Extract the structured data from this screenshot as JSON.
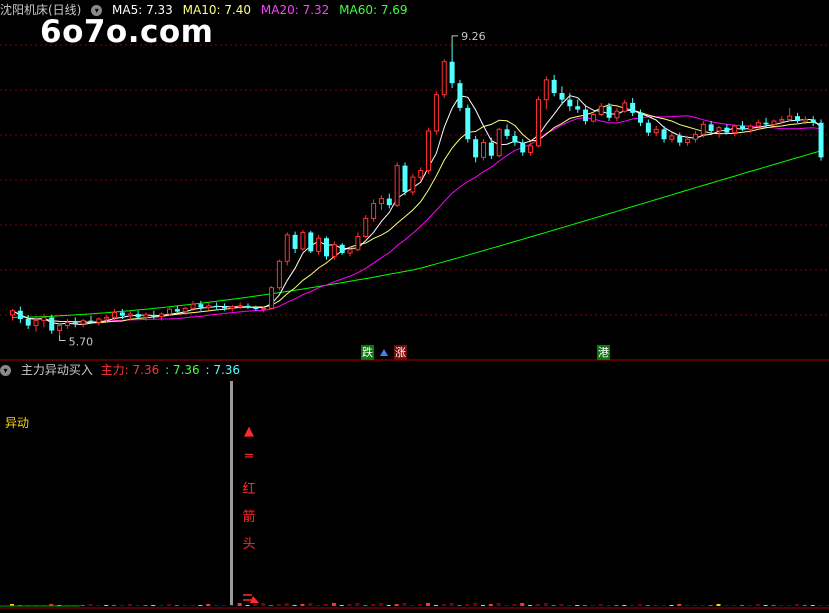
{
  "header": {
    "title": "沈阳机床(日线)",
    "ma5": "MA5: 7.33",
    "ma10": "MA10: 7.40",
    "ma20": "MA20: 7.32",
    "ma60": "MA60: 7.69",
    "toggle_glyph": "▾"
  },
  "watermark": "6o7o.com",
  "price_annotations": {
    "high": "9.26",
    "low": "5.70"
  },
  "event_tags": [
    {
      "text": "跌",
      "bg": "#0a7a0a",
      "fg": "#ffffff"
    },
    {
      "text": "涨",
      "bg": "#7a0a0a",
      "fg": "#ffffff"
    },
    {
      "text": "港",
      "bg": "#0a7a0a",
      "fg": "#ffffff"
    }
  ],
  "indicator": {
    "title": "主力异动买入",
    "main_label": "主力: 7.36",
    "v2": ": 7.36",
    "v3": ": 7.36",
    "left_label": "异动",
    "vertical_label": [
      "▲",
      "=",
      "红",
      "箭",
      "头"
    ]
  },
  "colors": {
    "up": "#ff3232",
    "down": "#54ffff",
    "ma5": "#ffffff",
    "ma10": "#ffff80",
    "ma20": "#ff00ff",
    "ma60": "#00ff00",
    "grid": "#8a0000",
    "divider": "#b00000"
  },
  "chart_data": {
    "type": "candlestick",
    "high_marker": 9.26,
    "low_marker": 5.7,
    "ohlc": [
      [
        5.95,
        6.02,
        5.88,
        6.0
      ],
      [
        6.0,
        6.05,
        5.85,
        5.9
      ],
      [
        5.9,
        5.95,
        5.78,
        5.82
      ],
      [
        5.82,
        5.92,
        5.75,
        5.88
      ],
      [
        5.88,
        5.96,
        5.8,
        5.92
      ],
      [
        5.92,
        5.95,
        5.72,
        5.76
      ],
      [
        5.76,
        5.85,
        5.7,
        5.82
      ],
      [
        5.82,
        5.9,
        5.78,
        5.86
      ],
      [
        5.86,
        5.92,
        5.8,
        5.84
      ],
      [
        5.84,
        5.9,
        5.8,
        5.88
      ],
      [
        5.88,
        5.94,
        5.84,
        5.86
      ],
      [
        5.86,
        5.92,
        5.82,
        5.9
      ],
      [
        5.9,
        5.95,
        5.86,
        5.92
      ],
      [
        5.92,
        6.02,
        5.88,
        5.98
      ],
      [
        5.98,
        6.02,
        5.9,
        5.94
      ],
      [
        5.94,
        6.0,
        5.88,
        5.96
      ],
      [
        5.96,
        6.0,
        5.9,
        5.92
      ],
      [
        5.92,
        5.98,
        5.88,
        5.95
      ],
      [
        5.95,
        6.0,
        5.9,
        5.93
      ],
      [
        5.93,
        5.98,
        5.88,
        5.96
      ],
      [
        5.96,
        6.04,
        5.94,
        6.02
      ],
      [
        6.02,
        6.06,
        5.96,
        5.99
      ],
      [
        5.99,
        6.05,
        5.95,
        6.03
      ],
      [
        6.03,
        6.12,
        6.0,
        6.08
      ],
      [
        6.08,
        6.12,
        6.0,
        6.04
      ],
      [
        6.04,
        6.1,
        6.0,
        6.06
      ],
      [
        6.06,
        6.1,
        6.02,
        6.05
      ],
      [
        6.05,
        6.09,
        6.0,
        6.03
      ],
      [
        6.03,
        6.07,
        5.99,
        6.05
      ],
      [
        6.05,
        6.1,
        6.02,
        6.06
      ],
      [
        6.06,
        6.09,
        6.02,
        6.04
      ],
      [
        6.04,
        6.06,
        6.0,
        6.02
      ],
      [
        6.02,
        6.05,
        5.98,
        6.03
      ],
      [
        6.03,
        6.3,
        6.02,
        6.28
      ],
      [
        6.28,
        6.62,
        6.25,
        6.6
      ],
      [
        6.6,
        6.95,
        6.55,
        6.92
      ],
      [
        6.92,
        6.96,
        6.7,
        6.75
      ],
      [
        6.75,
        6.98,
        6.72,
        6.95
      ],
      [
        6.95,
        6.97,
        6.7,
        6.72
      ],
      [
        6.72,
        6.92,
        6.68,
        6.88
      ],
      [
        6.88,
        6.9,
        6.62,
        6.66
      ],
      [
        6.66,
        6.84,
        6.62,
        6.8
      ],
      [
        6.8,
        6.82,
        6.68,
        6.7
      ],
      [
        6.7,
        6.78,
        6.66,
        6.74
      ],
      [
        6.74,
        6.95,
        6.72,
        6.9
      ],
      [
        6.9,
        7.16,
        6.88,
        7.12
      ],
      [
        7.12,
        7.35,
        7.08,
        7.3
      ],
      [
        7.3,
        7.4,
        7.22,
        7.36
      ],
      [
        7.36,
        7.42,
        7.24,
        7.28
      ],
      [
        7.28,
        7.8,
        7.26,
        7.76
      ],
      [
        7.76,
        7.8,
        7.4,
        7.44
      ],
      [
        7.44,
        7.66,
        7.4,
        7.62
      ],
      [
        7.62,
        7.74,
        7.58,
        7.7
      ],
      [
        7.7,
        8.22,
        7.66,
        8.18
      ],
      [
        8.18,
        8.66,
        8.14,
        8.62
      ],
      [
        8.62,
        9.05,
        8.58,
        9.02
      ],
      [
        9.02,
        9.26,
        8.7,
        8.76
      ],
      [
        8.76,
        8.8,
        8.42,
        8.46
      ],
      [
        8.46,
        8.5,
        8.04,
        8.08
      ],
      [
        8.08,
        8.12,
        7.8,
        7.86
      ],
      [
        7.86,
        8.08,
        7.82,
        8.04
      ],
      [
        8.04,
        8.1,
        7.84,
        7.88
      ],
      [
        7.88,
        8.22,
        7.86,
        8.2
      ],
      [
        8.2,
        8.26,
        8.08,
        8.12
      ],
      [
        8.12,
        8.18,
        8.0,
        8.04
      ],
      [
        8.04,
        8.08,
        7.88,
        7.92
      ],
      [
        7.92,
        8.04,
        7.88,
        8.0
      ],
      [
        8.0,
        8.6,
        7.98,
        8.56
      ],
      [
        8.56,
        8.84,
        8.44,
        8.8
      ],
      [
        8.8,
        8.86,
        8.6,
        8.64
      ],
      [
        8.64,
        8.72,
        8.5,
        8.56
      ],
      [
        8.56,
        8.64,
        8.42,
        8.48
      ],
      [
        8.48,
        8.56,
        8.4,
        8.44
      ],
      [
        8.44,
        8.5,
        8.26,
        8.3
      ],
      [
        8.3,
        8.42,
        8.28,
        8.38
      ],
      [
        8.38,
        8.52,
        8.36,
        8.48
      ],
      [
        8.48,
        8.52,
        8.3,
        8.34
      ],
      [
        8.34,
        8.46,
        8.3,
        8.42
      ],
      [
        8.42,
        8.56,
        8.4,
        8.52
      ],
      [
        8.52,
        8.58,
        8.36,
        8.4
      ],
      [
        8.4,
        8.44,
        8.24,
        8.28
      ],
      [
        8.28,
        8.32,
        8.12,
        8.16
      ],
      [
        8.16,
        8.24,
        8.12,
        8.2
      ],
      [
        8.2,
        8.24,
        8.04,
        8.08
      ],
      [
        8.08,
        8.16,
        8.04,
        8.12
      ],
      [
        8.12,
        8.16,
        8.0,
        8.04
      ],
      [
        8.04,
        8.12,
        8.0,
        8.08
      ],
      [
        8.08,
        8.18,
        8.04,
        8.14
      ],
      [
        8.14,
        8.3,
        8.1,
        8.26
      ],
      [
        8.26,
        8.3,
        8.14,
        8.18
      ],
      [
        8.18,
        8.24,
        8.1,
        8.22
      ],
      [
        8.22,
        8.26,
        8.14,
        8.16
      ],
      [
        8.16,
        8.26,
        8.12,
        8.24
      ],
      [
        8.24,
        8.3,
        8.18,
        8.2
      ],
      [
        8.2,
        8.26,
        8.16,
        8.24
      ],
      [
        8.24,
        8.32,
        8.2,
        8.28
      ],
      [
        8.28,
        8.34,
        8.22,
        8.26
      ],
      [
        8.26,
        8.32,
        8.24,
        8.3
      ],
      [
        8.3,
        8.36,
        8.26,
        8.32
      ],
      [
        8.32,
        8.46,
        8.3,
        8.36
      ],
      [
        8.36,
        8.4,
        8.28,
        8.3
      ],
      [
        8.3,
        8.36,
        8.26,
        8.32
      ],
      [
        8.32,
        8.36,
        8.24,
        8.28
      ],
      [
        8.28,
        8.32,
        7.82,
        7.86
      ]
    ]
  }
}
